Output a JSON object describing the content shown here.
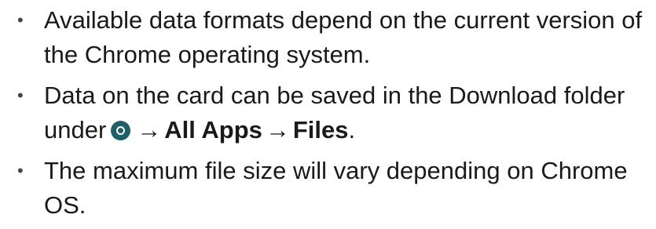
{
  "notes": {
    "bullet": "•",
    "item1": "Available data formats depend on the current version of the Chrome operating system.",
    "item2": {
      "prefix": "Data on the card can be saved in the Download folder under",
      "icon": "launcher-circle-icon",
      "icon_color": "#1f5f66",
      "arrow": "→",
      "step1": "All Apps",
      "step2": "Files",
      "suffix": "."
    },
    "item3": "The maximum file size will vary depending on Chrome OS."
  }
}
